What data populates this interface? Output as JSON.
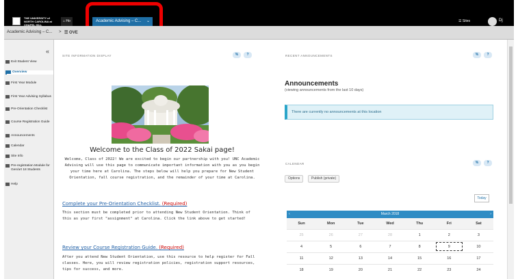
{
  "header": {
    "logo_text": "THE UNIVERSITY of NORTH CAROLINA at CHAPEL HILL",
    "home_label": "Ho",
    "site_tab_label": "Academic Advising – C...",
    "sites_label": "Sites",
    "user_initials": "Dj"
  },
  "breadcrumb": {
    "site": "Academic Advising – C...",
    "separator": ">",
    "page": "OVE"
  },
  "sidebar": {
    "collapse_icon": "«",
    "items": [
      {
        "label": "Exit Student View"
      },
      {
        "label": "Overview"
      },
      {
        "label": "First Year Module"
      },
      {
        "label": "First Year Advising Syllabus"
      },
      {
        "label": "Pre-Orientation Checklist"
      },
      {
        "label": "Course Registration Guide"
      },
      {
        "label": "Announcements"
      },
      {
        "label": "Calendar"
      },
      {
        "label": "Site Info"
      },
      {
        "label": "Pre-registration Module for Gen/art 18 Students"
      },
      {
        "label": "Help"
      }
    ]
  },
  "site_info": {
    "label": "SITE INFORMATION DISPLAY",
    "welcome_title": "Welcome to the Class of 2022 Sakai page!",
    "welcome_text": "Welcome, Class of 2022! We are excited to begin our partnership with you! UNC Academic Advising will use this page to communicate important information with you as you begin your time here at Carolina. The steps below will help you prepare for New Student Orientation, fall course registration, and the remainder of your time at Carolina.",
    "section1_link": "Complete your Pre-Orientation Checklist.",
    "section1_req": "(Required)",
    "section1_text": "This section must be completed prior to attending New Student Orientation. Think of this as your first \"assignment\" at Carolina. Click the link above to get started!",
    "section2_link": "Review your Course Registration Guide.",
    "section2_req": "(Required)",
    "section2_text": "After you attend New Student Orientation, use this resource to help register for Fall classes. Here, you will review registration policies, registration support resources, tips for success, and more."
  },
  "announcements": {
    "label": "RECENT ANNOUNCEMENTS",
    "title": "Announcements",
    "subtitle": "(viewing announcements from the last 10 days)",
    "empty_text": "There are currently no announcements at this location"
  },
  "calendar": {
    "label": "CALENDAR",
    "options_label": "Options",
    "publish_label": "Publish (private)",
    "today_label": "Today",
    "month_title": "March 2018",
    "prev_arrow": "‹",
    "next_arrow": "›",
    "weekdays": [
      "Sun",
      "Mon",
      "Tue",
      "Wed",
      "Thu",
      "Fri",
      "Sat"
    ],
    "weeks": [
      [
        "25",
        "26",
        "27",
        "28",
        "1",
        "2",
        "3"
      ],
      [
        "4",
        "5",
        "6",
        "7",
        "8",
        "9",
        "10"
      ],
      [
        "11",
        "12",
        "13",
        "14",
        "15",
        "16",
        "17"
      ],
      [
        "18",
        "19",
        "20",
        "21",
        "22",
        "23",
        "24"
      ]
    ]
  },
  "panel_buttons": {
    "link_glyph": "%",
    "help_glyph": "?"
  }
}
